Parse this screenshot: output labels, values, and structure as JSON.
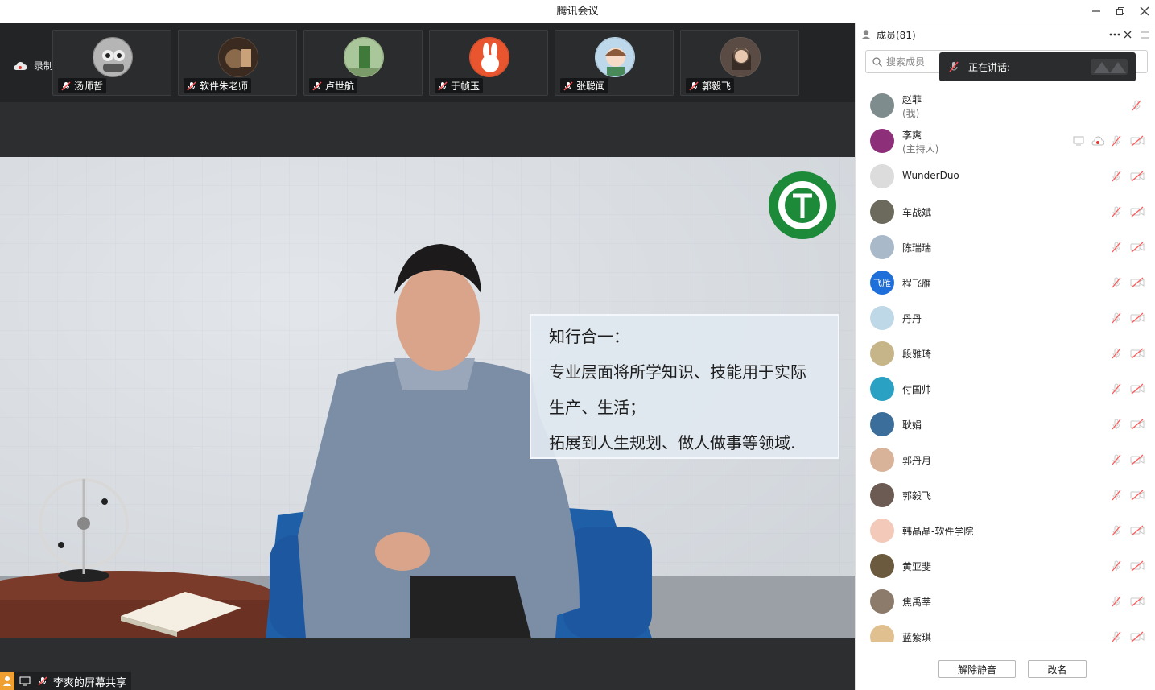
{
  "window": {
    "title": "腾讯会议"
  },
  "recording": {
    "label": "录制中"
  },
  "tiles": [
    {
      "name": "汤师哲",
      "color": "#8a8a8a"
    },
    {
      "name": "软件朱老师",
      "color": "#5b4636"
    },
    {
      "name": "卢世航",
      "color": "#9fb88a"
    },
    {
      "name": "于帧玉",
      "color": "#e0512c"
    },
    {
      "name": "张聪闻",
      "color": "#b7d3e8"
    },
    {
      "name": "郭毅飞",
      "color": "#6b5b52"
    }
  ],
  "slide": {
    "lines": [
      "知行合一：",
      "专业层面将所学知识、技能用于实际",
      "生产、生活；",
      "拓展到人生规划、做人做事等领域."
    ]
  },
  "screen_share": {
    "label": "李爽的屏幕共享"
  },
  "panel": {
    "title": "成员(81)",
    "search_placeholder": "搜索成员",
    "speaking_label": "正在讲话:",
    "members": [
      {
        "name": "赵菲",
        "role": "(我)",
        "avatar": "#7f8c8d"
      },
      {
        "name": "李爽",
        "role": "(主持人)",
        "avatar": "#8e2f7a"
      },
      {
        "name": "WunderDuo",
        "role": "",
        "avatar": "#dcdcdc"
      },
      {
        "name": "车战斌",
        "role": "",
        "avatar": "#6c6a5c"
      },
      {
        "name": "陈瑞瑞",
        "role": "",
        "avatar": "#a9b9c9"
      },
      {
        "name": "程飞雁",
        "role": "",
        "avatar": "#1e6fd9",
        "initials": "飞雁"
      },
      {
        "name": "丹丹",
        "role": "",
        "avatar": "#bfd8e8"
      },
      {
        "name": "段雅琦",
        "role": "",
        "avatar": "#c7b58a"
      },
      {
        "name": "付国帅",
        "role": "",
        "avatar": "#2aa1c2"
      },
      {
        "name": "耿娟",
        "role": "",
        "avatar": "#3b6e9a"
      },
      {
        "name": "郭丹月",
        "role": "",
        "avatar": "#d8b39a"
      },
      {
        "name": "郭毅飞",
        "role": "",
        "avatar": "#6b5b52"
      },
      {
        "name": "韩晶晶-软件学院",
        "role": "",
        "avatar": "#f3c9b9"
      },
      {
        "name": "黄亚斐",
        "role": "",
        "avatar": "#6b5a3e"
      },
      {
        "name": "焦禹莘",
        "role": "",
        "avatar": "#8c7a6b"
      },
      {
        "name": "蓝紫琪",
        "role": "",
        "avatar": "#e1c08f"
      }
    ],
    "buttons": {
      "unmute": "解除静音",
      "rename": "改名"
    }
  }
}
